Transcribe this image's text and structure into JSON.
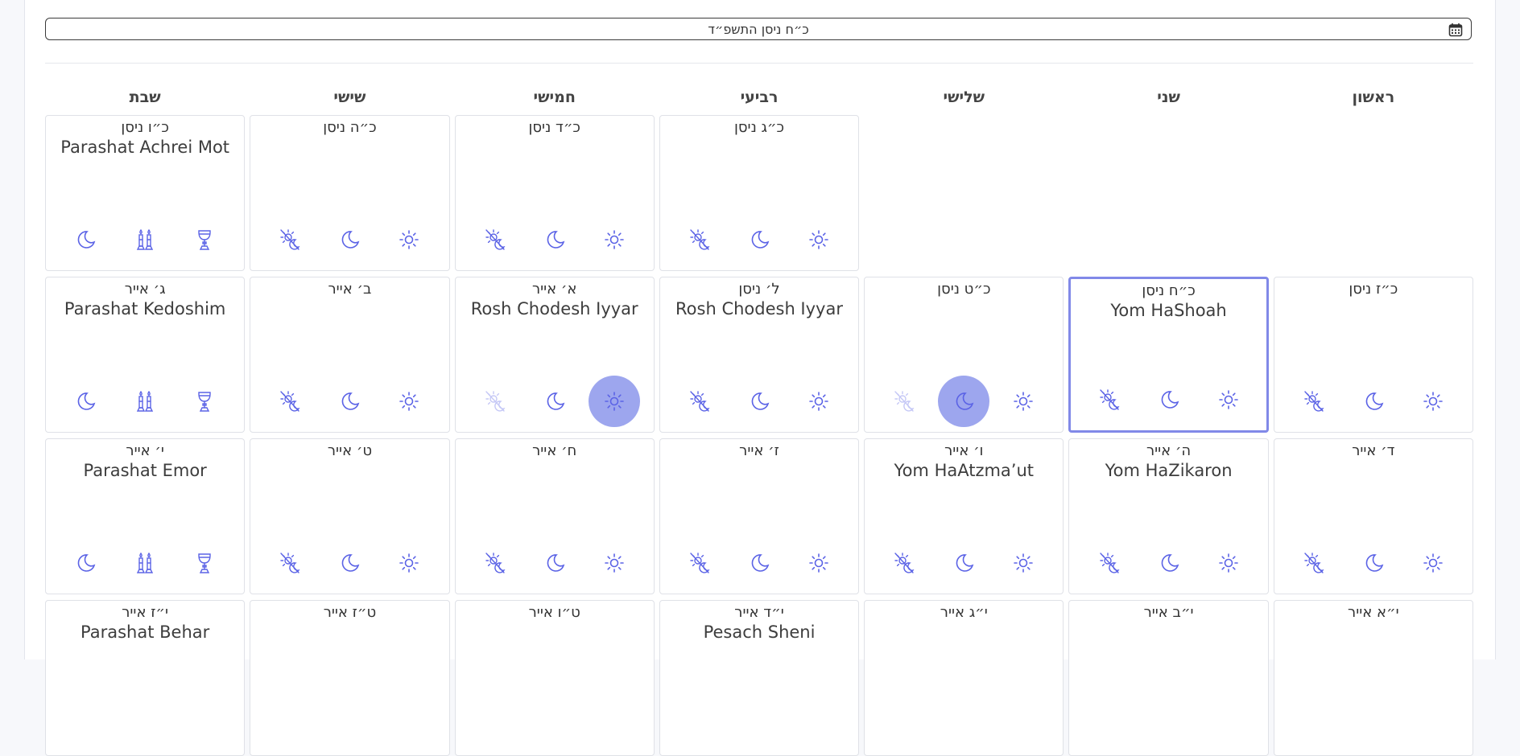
{
  "date_input": {
    "value": "כ״ח ניסן התשפ״ד"
  },
  "week_days": [
    "ראשון",
    "שני",
    "שלישי",
    "רביעי",
    "חמישי",
    "שישי",
    "שבת"
  ],
  "weeks": [
    [
      null,
      null,
      null,
      {
        "heb": "כ״ג ניסן",
        "event": "",
        "icons": [
          "fast-icon",
          "night-icon",
          "day-icon"
        ]
      },
      {
        "heb": "כ״ד ניסן",
        "event": "",
        "icons": [
          "fast-icon",
          "night-icon",
          "day-icon"
        ]
      },
      {
        "heb": "כ״ה ניסן",
        "event": "",
        "icons": [
          "fast-icon",
          "night-icon",
          "day-icon"
        ]
      },
      {
        "heb": "כ״ו ניסן",
        "event": "Parashat Achrei Mot",
        "icons": [
          "night-icon",
          "candles-icon",
          "kiddush-cup-icon"
        ]
      }
    ],
    [
      {
        "heb": "כ״ז ניסן",
        "event": "",
        "icons": [
          "fast-icon",
          "night-icon",
          "day-icon"
        ]
      },
      {
        "heb": "כ״ח ניסן",
        "event": "Yom HaShoah",
        "icons": [
          "fast-icon",
          "night-icon",
          "day-icon"
        ],
        "selected": true
      },
      {
        "heb": "כ״ט ניסן",
        "event": "",
        "icons": [
          "fast-icon",
          "night-icon",
          "day-icon"
        ],
        "active": "night-icon",
        "faded": "fast-icon"
      },
      {
        "heb": "ל׳ ניסן",
        "event": "Rosh Chodesh Iyyar",
        "icons": [
          "fast-icon",
          "night-icon",
          "day-icon"
        ]
      },
      {
        "heb": "א׳ אייר",
        "event": "Rosh Chodesh Iyyar",
        "icons": [
          "fast-icon",
          "night-icon",
          "day-icon"
        ],
        "active": "day-icon",
        "faded": "fast-icon"
      },
      {
        "heb": "ב׳ אייר",
        "event": "",
        "icons": [
          "fast-icon",
          "night-icon",
          "day-icon"
        ]
      },
      {
        "heb": "ג׳ אייר",
        "event": "Parashat Kedoshim",
        "icons": [
          "night-icon",
          "candles-icon",
          "kiddush-cup-icon"
        ]
      }
    ],
    [
      {
        "heb": "ד׳ אייר",
        "event": "",
        "icons": [
          "fast-icon",
          "night-icon",
          "day-icon"
        ]
      },
      {
        "heb": "ה׳ אייר",
        "event": "Yom HaZikaron",
        "icons": [
          "fast-icon",
          "night-icon",
          "day-icon"
        ]
      },
      {
        "heb": "ו׳ אייר",
        "event": "Yom HaAtzma’ut",
        "icons": [
          "fast-icon",
          "night-icon",
          "day-icon"
        ]
      },
      {
        "heb": "ז׳ אייר",
        "event": "",
        "icons": [
          "fast-icon",
          "night-icon",
          "day-icon"
        ]
      },
      {
        "heb": "ח׳ אייר",
        "event": "",
        "icons": [
          "fast-icon",
          "night-icon",
          "day-icon"
        ]
      },
      {
        "heb": "ט׳ אייר",
        "event": "",
        "icons": [
          "fast-icon",
          "night-icon",
          "day-icon"
        ]
      },
      {
        "heb": "י׳ אייר",
        "event": "Parashat Emor",
        "icons": [
          "night-icon",
          "candles-icon",
          "kiddush-cup-icon"
        ]
      }
    ],
    [
      {
        "heb": "י״א אייר",
        "event": "",
        "icons": []
      },
      {
        "heb": "י״ב אייר",
        "event": "",
        "icons": []
      },
      {
        "heb": "י״ג אייר",
        "event": "",
        "icons": []
      },
      {
        "heb": "י״ד אייר",
        "event": "Pesach Sheni",
        "icons": []
      },
      {
        "heb": "ט״ו אייר",
        "event": "",
        "icons": []
      },
      {
        "heb": "ט״ז אייר",
        "event": "",
        "icons": []
      },
      {
        "heb": "י״ז אייר",
        "event": "Parashat Behar",
        "icons": []
      }
    ]
  ],
  "colors": {
    "accent": "#5b63e6",
    "active_bg": "#9da6ee",
    "selected_border": "#8189e8"
  }
}
